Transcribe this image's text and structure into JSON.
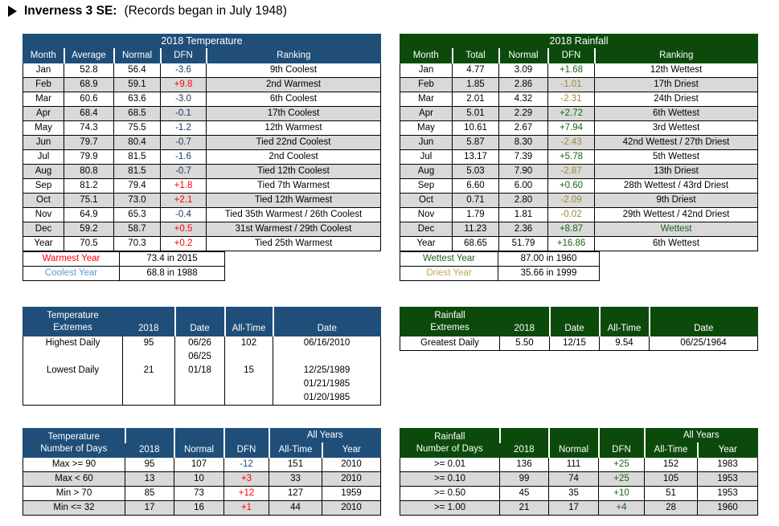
{
  "header": {
    "bullet_icon": "triangle-right-icon",
    "station": "Inverness 3 SE:",
    "records_note": "(Records began in July 1948)"
  },
  "temperature_table": {
    "title": "2018 Temperature",
    "columns": [
      "Month",
      "Average",
      "Normal",
      "DFN",
      "Ranking"
    ],
    "rows": [
      {
        "month": "Jan",
        "average": "52.8",
        "normal": "56.4",
        "dfn": "-3.6",
        "dfn_sign": "neg",
        "ranking": "9th Coolest"
      },
      {
        "month": "Feb",
        "average": "68.9",
        "normal": "59.1",
        "dfn": "+9.8",
        "dfn_sign": "pos",
        "ranking": "2nd Warmest"
      },
      {
        "month": "Mar",
        "average": "60.6",
        "normal": "63.6",
        "dfn": "-3.0",
        "dfn_sign": "neg",
        "ranking": "6th Coolest"
      },
      {
        "month": "Apr",
        "average": "68.4",
        "normal": "68.5",
        "dfn": "-0.1",
        "dfn_sign": "neg",
        "ranking": "17th Coolest"
      },
      {
        "month": "May",
        "average": "74.3",
        "normal": "75.5",
        "dfn": "-1.2",
        "dfn_sign": "neg",
        "ranking": "12th Warmest"
      },
      {
        "month": "Jun",
        "average": "79.7",
        "normal": "80.4",
        "dfn": "-0.7",
        "dfn_sign": "neg",
        "ranking": "Tied 22nd Coolest"
      },
      {
        "month": "Jul",
        "average": "79.9",
        "normal": "81.5",
        "dfn": "-1.6",
        "dfn_sign": "neg",
        "ranking": "2nd Coolest"
      },
      {
        "month": "Aug",
        "average": "80.8",
        "normal": "81.5",
        "dfn": "-0.7",
        "dfn_sign": "neg",
        "ranking": "Tied 12th Coolest"
      },
      {
        "month": "Sep",
        "average": "81.2",
        "normal": "79.4",
        "dfn": "+1.8",
        "dfn_sign": "pos",
        "ranking": "Tied 7th Warmest"
      },
      {
        "month": "Oct",
        "average": "75.1",
        "normal": "73.0",
        "dfn": "+2.1",
        "dfn_sign": "pos",
        "ranking": "Tied 12th Warmest"
      },
      {
        "month": "Nov",
        "average": "64.9",
        "normal": "65.3",
        "dfn": "-0.4",
        "dfn_sign": "neg",
        "ranking": "Tied 35th Warmest / 26th Coolest"
      },
      {
        "month": "Dec",
        "average": "59.2",
        "normal": "58.7",
        "dfn": "+0.5",
        "dfn_sign": "pos",
        "ranking": "31st Warmest / 29th Coolest"
      },
      {
        "month": "Year",
        "average": "70.5",
        "normal": "70.3",
        "dfn": "+0.2",
        "dfn_sign": "pos",
        "ranking": "Tied 25th Warmest"
      }
    ]
  },
  "rainfall_table": {
    "title": "2018 Rainfall",
    "columns": [
      "Month",
      "Total",
      "Normal",
      "DFN",
      "Ranking"
    ],
    "rows": [
      {
        "month": "Jan",
        "total": "4.77",
        "normal": "3.09",
        "dfn": "+1.68",
        "dfn_sign": "pos",
        "ranking": "12th Wettest",
        "rank_style": "plain"
      },
      {
        "month": "Feb",
        "total": "1.85",
        "normal": "2.86",
        "dfn": "-1.01",
        "dfn_sign": "neg",
        "ranking": "17th Driest",
        "rank_style": "plain"
      },
      {
        "month": "Mar",
        "total": "2.01",
        "normal": "4.32",
        "dfn": "-2.31",
        "dfn_sign": "neg",
        "ranking": "24th Driest",
        "rank_style": "plain"
      },
      {
        "month": "Apr",
        "total": "5.01",
        "normal": "2.29",
        "dfn": "+2.72",
        "dfn_sign": "pos",
        "ranking": "6th Wettest",
        "rank_style": "plain"
      },
      {
        "month": "May",
        "total": "10.61",
        "normal": "2.67",
        "dfn": "+7.94",
        "dfn_sign": "pos",
        "ranking": "3rd Wettest",
        "rank_style": "plain"
      },
      {
        "month": "Jun",
        "total": "5.87",
        "normal": "8.30",
        "dfn": "-2.43",
        "dfn_sign": "neg",
        "ranking": "42nd Wettest / 27th Driest",
        "rank_style": "plain"
      },
      {
        "month": "Jul",
        "total": "13.17",
        "normal": "7.39",
        "dfn": "+5.78",
        "dfn_sign": "pos",
        "ranking": "5th Wettest",
        "rank_style": "plain"
      },
      {
        "month": "Aug",
        "total": "5.03",
        "normal": "7.90",
        "dfn": "-2.87",
        "dfn_sign": "neg",
        "ranking": "13th Driest",
        "rank_style": "plain"
      },
      {
        "month": "Sep",
        "total": "6.60",
        "normal": "6.00",
        "dfn": "+0.60",
        "dfn_sign": "pos",
        "ranking": "28th Wettest / 43rd Driest",
        "rank_style": "plain"
      },
      {
        "month": "Oct",
        "total": "0.71",
        "normal": "2.80",
        "dfn": "-2.09",
        "dfn_sign": "neg",
        "ranking": "9th Driest",
        "rank_style": "plain"
      },
      {
        "month": "Nov",
        "total": "1.79",
        "normal": "1.81",
        "dfn": "-0.02",
        "dfn_sign": "neg",
        "ranking": "29th Wettest / 42nd Driest",
        "rank_style": "plain"
      },
      {
        "month": "Dec",
        "total": "11.23",
        "normal": "2.36",
        "dfn": "+8.87",
        "dfn_sign": "pos",
        "ranking": "Wettest",
        "rank_style": "green-bold"
      },
      {
        "month": "Year",
        "total": "68.65",
        "normal": "51.79",
        "dfn": "+16.86",
        "dfn_sign": "pos",
        "ranking": "6th Wettest",
        "rank_style": "plain"
      }
    ]
  },
  "temperature_year_box": {
    "rows": [
      {
        "label": "Warmest Year",
        "value": "73.4 in 2015"
      },
      {
        "label": "Coolest Year",
        "value": "68.8 in 1988"
      }
    ]
  },
  "rainfall_year_box": {
    "rows": [
      {
        "label": "Wettest Year",
        "value": "87.00 in 1960"
      },
      {
        "label": "Driest Year",
        "value": "35.66 in 1999"
      }
    ]
  },
  "temperature_extremes": {
    "header_line1": "Temperature",
    "header_line2": "Extremes",
    "columns": [
      "2018",
      "Date",
      "All-Time",
      "Date"
    ],
    "rows": [
      {
        "label": "Highest Daily",
        "value_2018": "95",
        "date_2018": [
          "06/26",
          "06/25"
        ],
        "all_time": "102",
        "all_time_dates": [
          "06/16/2010"
        ]
      },
      {
        "label": "Lowest Daily",
        "value_2018": "21",
        "date_2018": [
          "01/18"
        ],
        "all_time": "15",
        "all_time_dates": [
          "12/25/1989",
          "01/21/1985",
          "01/20/1985"
        ]
      }
    ]
  },
  "rainfall_extremes": {
    "header_line1": "Rainfall",
    "header_line2": "Extremes",
    "columns": [
      "2018",
      "Date",
      "All-Time",
      "Date"
    ],
    "rows": [
      {
        "label": "Greatest Daily",
        "value_2018": "5.50",
        "date_2018": "12/15",
        "all_time": "9.54",
        "all_time_date": "06/25/1964"
      }
    ]
  },
  "temperature_days": {
    "header_line1": "Temperature",
    "header_line2": "Number of Days",
    "group_header": "All Years",
    "columns": [
      "2018",
      "Normal",
      "DFN",
      "All-Time",
      "Year"
    ],
    "rows": [
      {
        "label": "Max >= 90",
        "y2018": "95",
        "normal": "107",
        "dfn": "-12",
        "dfn_sign": "neg",
        "all_time": "151",
        "year": "2010"
      },
      {
        "label": "Max < 60",
        "y2018": "13",
        "normal": "10",
        "dfn": "+3",
        "dfn_sign": "pos",
        "all_time": "33",
        "year": "2010"
      },
      {
        "label": "Min > 70",
        "y2018": "85",
        "normal": "73",
        "dfn": "+12",
        "dfn_sign": "pos",
        "all_time": "127",
        "year": "1959"
      },
      {
        "label": "Min <= 32",
        "y2018": "17",
        "normal": "16",
        "dfn": "+1",
        "dfn_sign": "pos",
        "all_time": "44",
        "year": "2010"
      }
    ]
  },
  "rainfall_days": {
    "header_line1": "Rainfall",
    "header_line2": "Number of Days",
    "group_header": "All Years",
    "columns": [
      "2018",
      "Normal",
      "DFN",
      "All-Time",
      "Year"
    ],
    "rows": [
      {
        "label": ">= 0.01",
        "y2018": "136",
        "normal": "111",
        "dfn": "+25",
        "dfn_sign": "pos",
        "all_time": "152",
        "year": "1983"
      },
      {
        "label": ">= 0.10",
        "y2018": "99",
        "normal": "74",
        "dfn": "+25",
        "dfn_sign": "pos",
        "all_time": "105",
        "year": "1953"
      },
      {
        "label": ">= 0.50",
        "y2018": "45",
        "normal": "35",
        "dfn": "+10",
        "dfn_sign": "pos",
        "all_time": "51",
        "year": "1953"
      },
      {
        "label": ">= 1.00",
        "y2018": "21",
        "normal": "17",
        "dfn": "+4",
        "dfn_sign": "pos",
        "all_time": "28",
        "year": "1960"
      }
    ]
  },
  "colors": {
    "temperature_header": "#1F4E79",
    "rainfall_header": "#0B4A0B",
    "positive_dfn": "#FF0000",
    "negative_dfn": "#1F3864",
    "rain_positive_dfn": "#196619",
    "rain_negative_dfn": "#998A3B",
    "alt_row": "#D9D9D9"
  }
}
